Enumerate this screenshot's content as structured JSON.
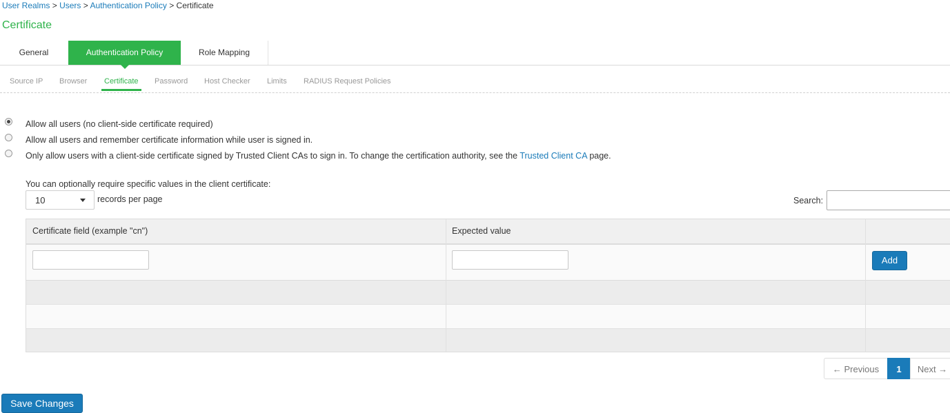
{
  "breadcrumb": {
    "items": [
      "User Realms",
      "Users",
      "Authentication Policy"
    ],
    "separator": ">",
    "current": "Certificate"
  },
  "page_title": "Certificate",
  "primary_tabs": [
    {
      "label": "General",
      "active": false
    },
    {
      "label": "Authentication Policy",
      "active": true
    },
    {
      "label": "Role Mapping",
      "active": false
    }
  ],
  "secondary_tabs": [
    {
      "label": "Source IP",
      "active": false
    },
    {
      "label": "Browser",
      "active": false
    },
    {
      "label": "Certificate",
      "active": true
    },
    {
      "label": "Password",
      "active": false
    },
    {
      "label": "Host Checker",
      "active": false
    },
    {
      "label": "Limits",
      "active": false
    },
    {
      "label": "RADIUS Request Policies",
      "active": false
    }
  ],
  "options": {
    "selected_index": 0,
    "opt1": "Allow all users (no client-side certificate required)",
    "opt2": "Allow all users and remember certificate information while user is signed in.",
    "opt3_prefix": "Only allow users with a client-side certificate signed by Trusted Client CAs to sign in. To change the certification authority, see the",
    "opt3_link": "Trusted Client CA",
    "opt3_suffix": "page."
  },
  "optional_note": "You can optionally require specific values in the client certificate:",
  "records": {
    "value": "10",
    "label": "records per page"
  },
  "search": {
    "label": "Search:",
    "value": ""
  },
  "table": {
    "columns": [
      "Certificate field (example \"cn\")",
      "Expected value",
      ""
    ],
    "add_label": "Add",
    "new_row": {
      "field": "",
      "value": ""
    }
  },
  "pagination": {
    "previous": "← Previous",
    "current": "1",
    "next": "Next →"
  },
  "save_label": "Save Changes",
  "colors": {
    "accent_green": "#2fb34b",
    "primary_blue": "#1a7bb9"
  }
}
